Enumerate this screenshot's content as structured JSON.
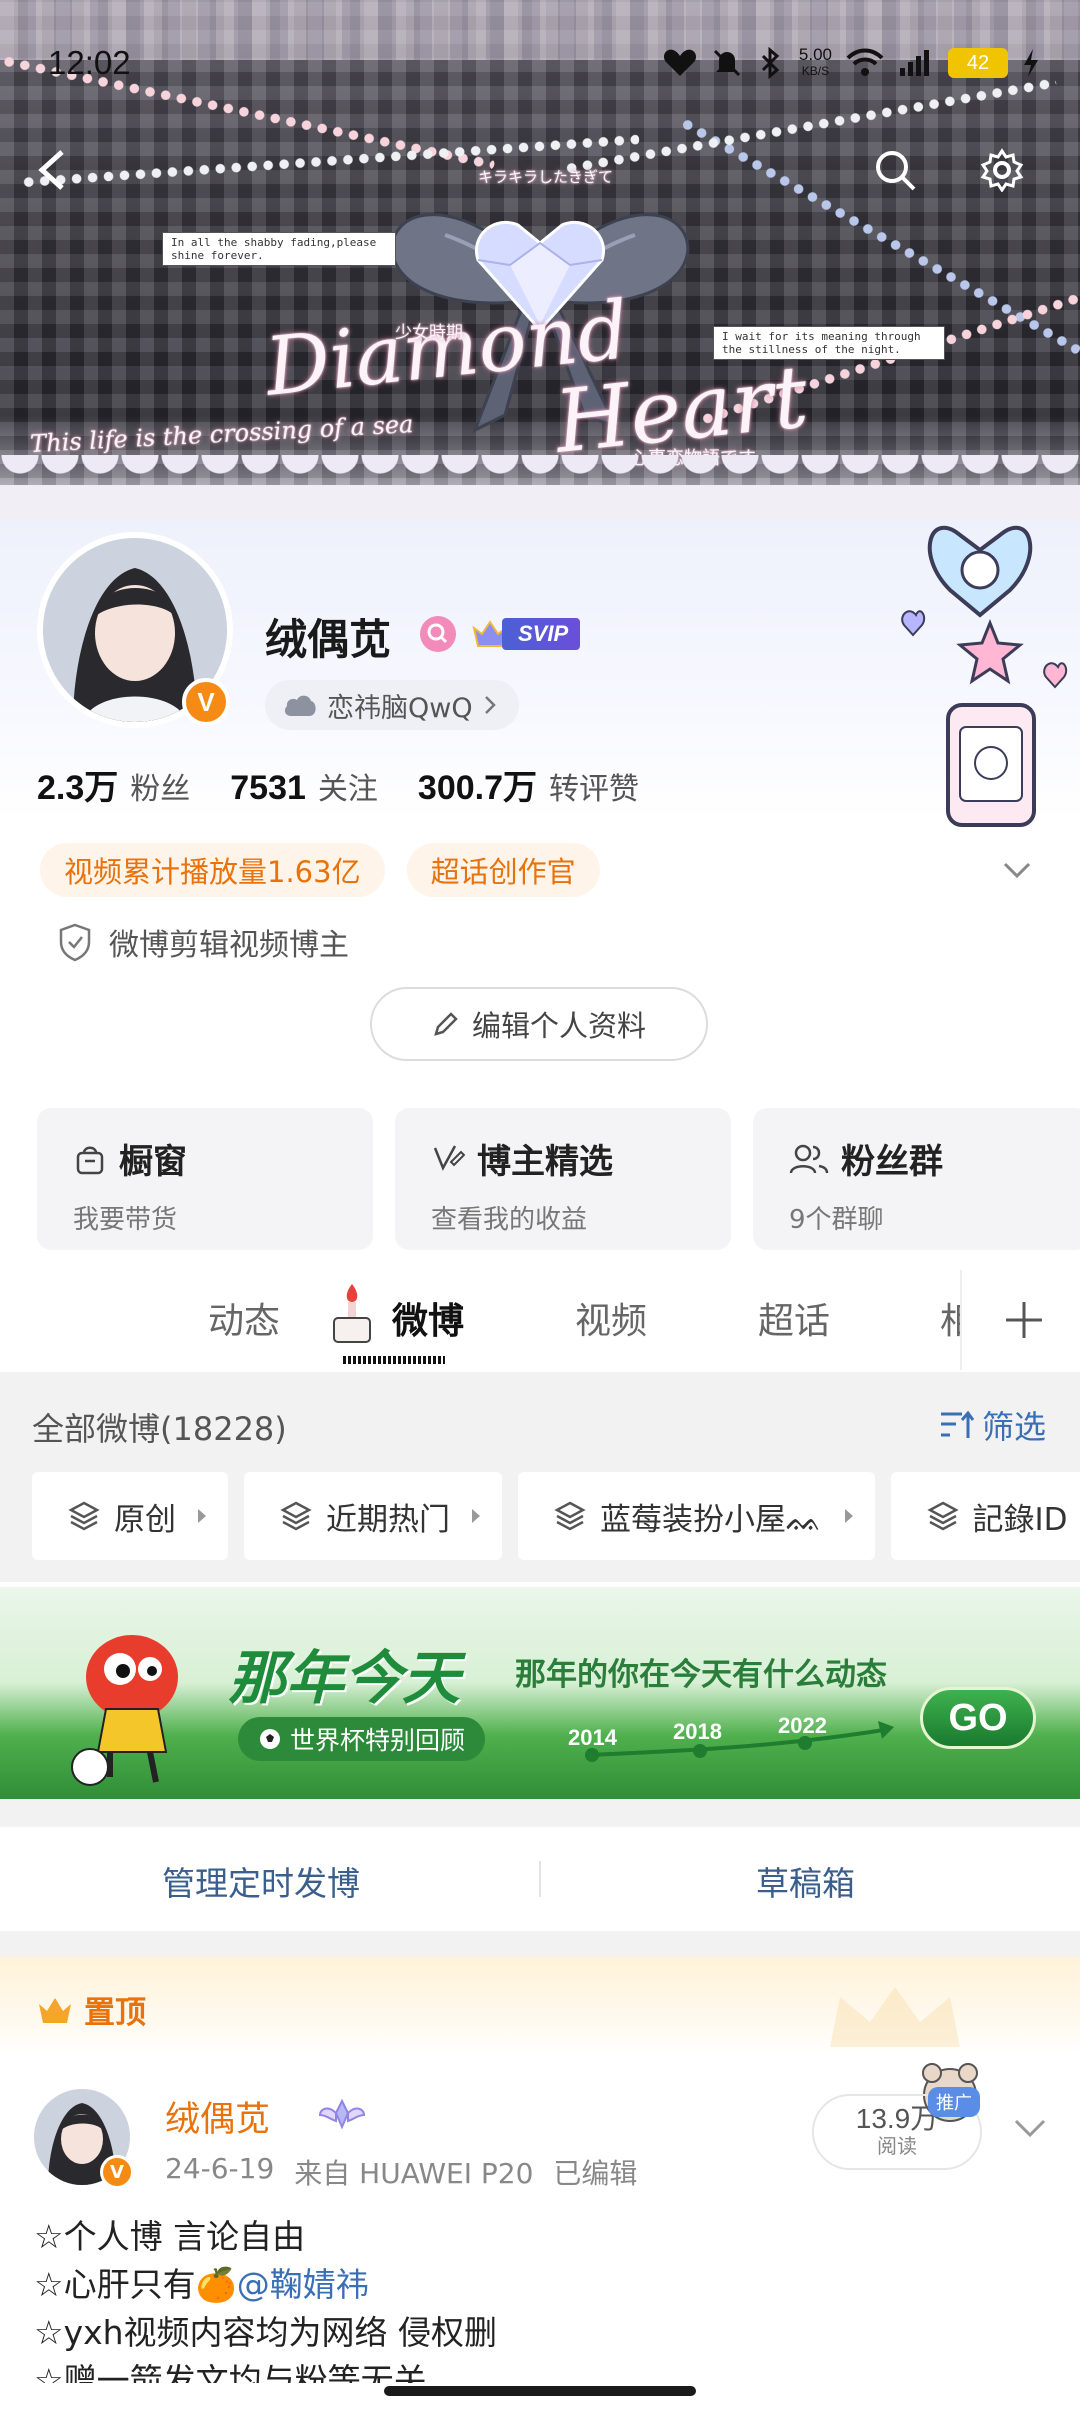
{
  "status_bar": {
    "time": "12:02",
    "net_speed_value": "5.00",
    "net_speed_unit": "KB/S",
    "battery": "42",
    "icons": [
      "heart-icon",
      "mute-icon",
      "bluetooth-icon",
      "wifi-icon",
      "signal-icon",
      "battery-icon",
      "charging-icon"
    ]
  },
  "banner": {
    "art_title_1": "Diamond",
    "art_title_2": "Heart",
    "note_left": "In all the shabby fading,please shine forever.",
    "note_right": "I wait for its meaning through the stillness of the night.",
    "art_sub_1": "少女時期",
    "art_sub_2": "心事恋物語です",
    "art_top": "キラキラしたきぎて",
    "art_bottom": "This life is the crossing of a sea"
  },
  "profile": {
    "nickname": "绒偶苋",
    "verified_letter": "V",
    "svip_label": "SVIP",
    "sub_label": "恋祎脑QwQ",
    "stats": [
      {
        "value": "2.3万",
        "label": "粉丝"
      },
      {
        "value": "7531",
        "label": "关注"
      },
      {
        "value": "300.7万",
        "label": "转评赞"
      }
    ],
    "tags": [
      "视频累计播放量1.63亿",
      "超话创作官"
    ],
    "certification": "微博剪辑视频博主",
    "edit_label": "编辑个人资料"
  },
  "cards": [
    {
      "title": "橱窗",
      "sub": "我要带货",
      "icon": "shop-bag-icon"
    },
    {
      "title": "博主精选",
      "sub": "查看我的收益",
      "icon": "check-edit-icon"
    },
    {
      "title": "粉丝群",
      "sub": "9个群聊",
      "icon": "group-icon"
    }
  ],
  "tabs": [
    "动态",
    "微博",
    "视频",
    "超话",
    "相"
  ],
  "active_tab": "微博",
  "filter": {
    "all_count": "全部微博(18228)",
    "filter_label": "筛选",
    "chips": [
      "原创",
      "近期热门",
      "蓝莓装扮小屋ᨐ",
      "記錄ID"
    ]
  },
  "promo": {
    "title": "那年今天",
    "subtitle": "那年的你在今天有什么动态",
    "pill": "世界杯特别回顾",
    "years": [
      "2014",
      "2018",
      "2022"
    ],
    "go": "GO"
  },
  "manage": {
    "scheduled": "管理定时发博",
    "drafts": "草稿箱"
  },
  "post": {
    "pin_label": "置顶",
    "author": "绒偶苋",
    "date": "24-6-19",
    "source": "来自 HUAWEI P20",
    "edited": "已编辑",
    "read_count": "13.9万",
    "read_label": "阅读",
    "promote": "推广",
    "lines": [
      "☆个人博 言论自由",
      "☆心肝只有🍊",
      "☆yxh视频内容均为网络 侵权删",
      "☆赠一箭发文均与粉等无关"
    ],
    "mention": "@鞠婧祎"
  },
  "colors": {
    "accent_orange": "#e8730c",
    "link_blue": "#3a6fb5",
    "svip_blue": "#4c60d6",
    "promo_green": "#1f8c3b"
  }
}
